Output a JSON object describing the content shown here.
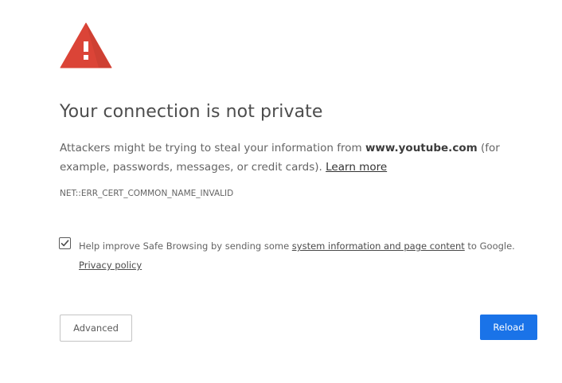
{
  "icon": {
    "name": "warning-triangle-icon",
    "color": "#db4437"
  },
  "title": "Your connection is not private",
  "description": {
    "prefix": "Attackers might be trying to steal your information from ",
    "domain": "www.youtube.com",
    "suffix": " (for example, passwords, messages, or credit cards). ",
    "learn_more": "Learn more"
  },
  "error_code": "NET::ERR_CERT_COMMON_NAME_INVALID",
  "safe_browsing": {
    "checked": true,
    "prefix": "Help improve Safe Browsing by sending some ",
    "link": "system information and page content",
    "suffix": " to Google.",
    "privacy_link": "Privacy policy"
  },
  "buttons": {
    "advanced": "Advanced",
    "reload": "Reload"
  },
  "colors": {
    "accent": "#1a73e8",
    "warning": "#db4437"
  }
}
